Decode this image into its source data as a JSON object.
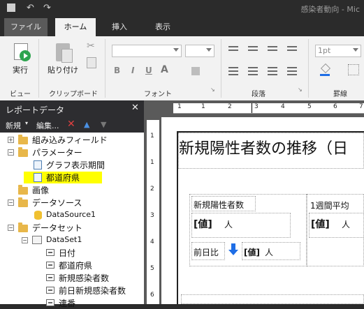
{
  "window": {
    "title": "感染者動向 - Mic",
    "quick_access": [
      "save-icon",
      "undo-icon",
      "redo-icon"
    ]
  },
  "ribbon": {
    "tabs": [
      {
        "label": "ファイル",
        "state": "file"
      },
      {
        "label": "ホーム",
        "state": "active"
      },
      {
        "label": "挿入",
        "state": "normal"
      },
      {
        "label": "表示",
        "state": "normal"
      }
    ],
    "groups": {
      "view": {
        "run_label": "実行",
        "group_label": "ビュー"
      },
      "clipboard": {
        "paste_label": "貼り付け",
        "group_label": "クリップボード"
      },
      "font": {
        "group_label": "フォント",
        "bold": "B",
        "italic": "I",
        "underline": "U",
        "font_color": "A"
      },
      "paragraph": {
        "group_label": "段落"
      },
      "border": {
        "group_label": "罫線",
        "line_width": "1pt"
      }
    }
  },
  "report_data": {
    "title": "レポートデータ",
    "toolbar": {
      "new_label": "新規",
      "edit_label": "編集..."
    },
    "tree": [
      {
        "label": "組み込みフィールド",
        "level": 0,
        "icon": "folder-icon",
        "expander": "+"
      },
      {
        "label": "パラメーター",
        "level": 0,
        "icon": "folder-icon",
        "expander": "-"
      },
      {
        "label": "グラフ表示期間",
        "level": 1,
        "icon": "parameter-icon"
      },
      {
        "label": "都道府県",
        "level": 1,
        "icon": "parameter-icon",
        "highlighted": true
      },
      {
        "label": "画像",
        "level": 0,
        "icon": "folder-icon"
      },
      {
        "label": "データソース",
        "level": 0,
        "icon": "folder-icon",
        "expander": "-"
      },
      {
        "label": "DataSource1",
        "level": 1,
        "icon": "datasource-icon"
      },
      {
        "label": "データセット",
        "level": 0,
        "icon": "folder-icon",
        "expander": "-"
      },
      {
        "label": "DataSet1",
        "level": 1,
        "icon": "dataset-icon",
        "expander": "-"
      },
      {
        "label": "日付",
        "level": 2,
        "icon": "field-icon"
      },
      {
        "label": "都道府県",
        "level": 2,
        "icon": "field-icon"
      },
      {
        "label": "新規感染者数",
        "level": 2,
        "icon": "field-icon"
      },
      {
        "label": "前日新規感染者数",
        "level": 2,
        "icon": "field-icon"
      },
      {
        "label": "連番",
        "level": 2,
        "icon": "field-icon"
      }
    ]
  },
  "designer": {
    "ruler_top": [
      "1",
      "1",
      "2",
      "3",
      "4",
      "5",
      "6",
      "7"
    ],
    "ruler_left": [
      "1",
      "1",
      "2",
      "3",
      "4",
      "5",
      "6"
    ],
    "report_title": "新規陽性者数の推移（日",
    "box1_label": "新規陽性者数",
    "value_placeholder": "[値]",
    "unit": "人",
    "prev_day_label": "前日比",
    "box2_label": "1週間平均",
    "colors": {
      "highlight": "#ffff00",
      "accent": "#1e6ee6"
    }
  }
}
